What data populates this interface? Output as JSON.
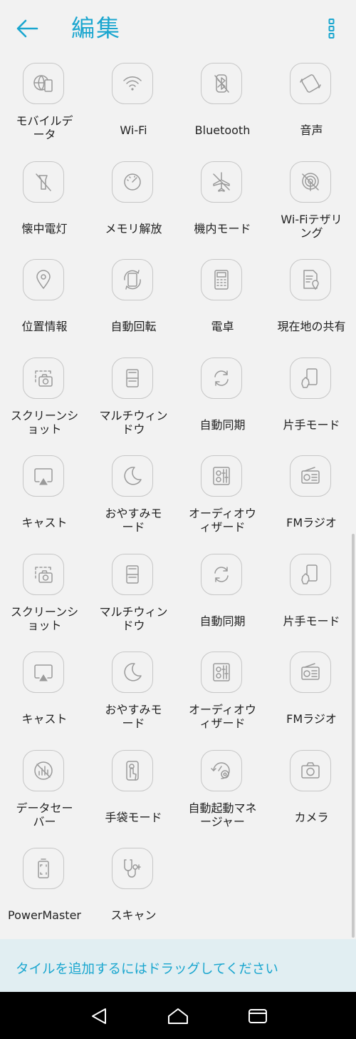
{
  "header": {
    "title": "編集",
    "back_icon": "arrow-left-icon",
    "menu_icon": "more-vertical-icon"
  },
  "colors": {
    "accent": "#1aa6cf",
    "tile_border": "#c6c6c6",
    "background": "#f2f2f2",
    "hint_bg": "#e1eef2"
  },
  "tiles": [
    {
      "label": "モバイルデータ",
      "icon": "mobile-data-icon",
      "lines": [
        "モバイルデ",
        "ータ"
      ]
    },
    {
      "label": "Wi-Fi",
      "icon": "wifi-icon",
      "lines": [
        "Wi-Fi"
      ]
    },
    {
      "label": "Bluetooth",
      "icon": "bluetooth-icon",
      "lines": [
        "Bluetooth"
      ]
    },
    {
      "label": "音声",
      "icon": "sound-icon",
      "lines": [
        "音声"
      ]
    },
    {
      "label": "懐中電灯",
      "icon": "flashlight-icon",
      "lines": [
        "懐中電灯"
      ]
    },
    {
      "label": "メモリ解放",
      "icon": "memory-boost-icon",
      "lines": [
        "メモリ解放"
      ]
    },
    {
      "label": "機内モード",
      "icon": "airplane-icon",
      "lines": [
        "機内モード"
      ]
    },
    {
      "label": "Wi-Fiテザリング",
      "icon": "hotspot-icon",
      "lines": [
        "Wi-Fiテザリ",
        "ング"
      ]
    },
    {
      "label": "位置情報",
      "icon": "location-icon",
      "lines": [
        "位置情報"
      ]
    },
    {
      "label": "自動回転",
      "icon": "auto-rotate-icon",
      "lines": [
        "自動回転"
      ]
    },
    {
      "label": "電卓",
      "icon": "calculator-icon",
      "lines": [
        "電卓"
      ]
    },
    {
      "label": "現在地の共有",
      "icon": "share-location-icon",
      "lines": [
        "現在地の共有"
      ]
    },
    {
      "label": "スクリーンショット",
      "icon": "screenshot-icon",
      "lines": [
        "スクリーンシ",
        "ョット"
      ]
    },
    {
      "label": "マルチウィンドウ",
      "icon": "multi-window-icon",
      "lines": [
        "マルチウィン",
        "ドウ"
      ]
    },
    {
      "label": "自動同期",
      "icon": "sync-icon",
      "lines": [
        "自動同期"
      ]
    },
    {
      "label": "片手モード",
      "icon": "one-hand-icon",
      "lines": [
        "片手モード"
      ]
    },
    {
      "label": "キャスト",
      "icon": "cast-icon",
      "lines": [
        "キャスト"
      ]
    },
    {
      "label": "おやすみモード",
      "icon": "moon-icon",
      "lines": [
        "おやすみモ",
        "ード"
      ]
    },
    {
      "label": "オーディオウィザード",
      "icon": "audio-wizard-icon",
      "lines": [
        "オーディオウ",
        "ィザード"
      ]
    },
    {
      "label": "FMラジオ",
      "icon": "radio-icon",
      "lines": [
        "FMラジオ"
      ]
    },
    {
      "label": "スクリーンショット",
      "icon": "screenshot-icon",
      "lines": [
        "スクリーンシ",
        "ョット"
      ]
    },
    {
      "label": "マルチウィンドウ",
      "icon": "multi-window-icon",
      "lines": [
        "マルチウィン",
        "ドウ"
      ]
    },
    {
      "label": "自動同期",
      "icon": "sync-icon",
      "lines": [
        "自動同期"
      ]
    },
    {
      "label": "片手モード",
      "icon": "one-hand-icon",
      "lines": [
        "片手モード"
      ]
    },
    {
      "label": "キャスト",
      "icon": "cast-icon",
      "lines": [
        "キャスト"
      ]
    },
    {
      "label": "おやすみモード",
      "icon": "moon-icon",
      "lines": [
        "おやすみモ",
        "ード"
      ]
    },
    {
      "label": "オーディオウィザード",
      "icon": "audio-wizard-icon",
      "lines": [
        "オーディオウ",
        "ィザード"
      ]
    },
    {
      "label": "FMラジオ",
      "icon": "radio-icon",
      "lines": [
        "FMラジオ"
      ]
    },
    {
      "label": "データセーバー",
      "icon": "data-saver-icon",
      "lines": [
        "データセー",
        "バー"
      ]
    },
    {
      "label": "手袋モード",
      "icon": "glove-icon",
      "lines": [
        "手袋モード"
      ]
    },
    {
      "label": "自動起動マネージャー",
      "icon": "auto-start-icon",
      "lines": [
        "自動起動マネ",
        "ージャー"
      ]
    },
    {
      "label": "カメラ",
      "icon": "camera-icon",
      "lines": [
        "カメラ"
      ]
    },
    {
      "label": "PowerMaster",
      "icon": "battery-icon",
      "lines": [
        "PowerMaster"
      ]
    },
    {
      "label": "スキャン",
      "icon": "scan-icon",
      "lines": [
        "スキャン"
      ]
    }
  ],
  "hint": {
    "text": "タイルを追加するにはドラッグしてください"
  },
  "navbar": {
    "back_icon": "nav-back-icon",
    "home_icon": "nav-home-icon",
    "recents_icon": "nav-recents-icon"
  }
}
